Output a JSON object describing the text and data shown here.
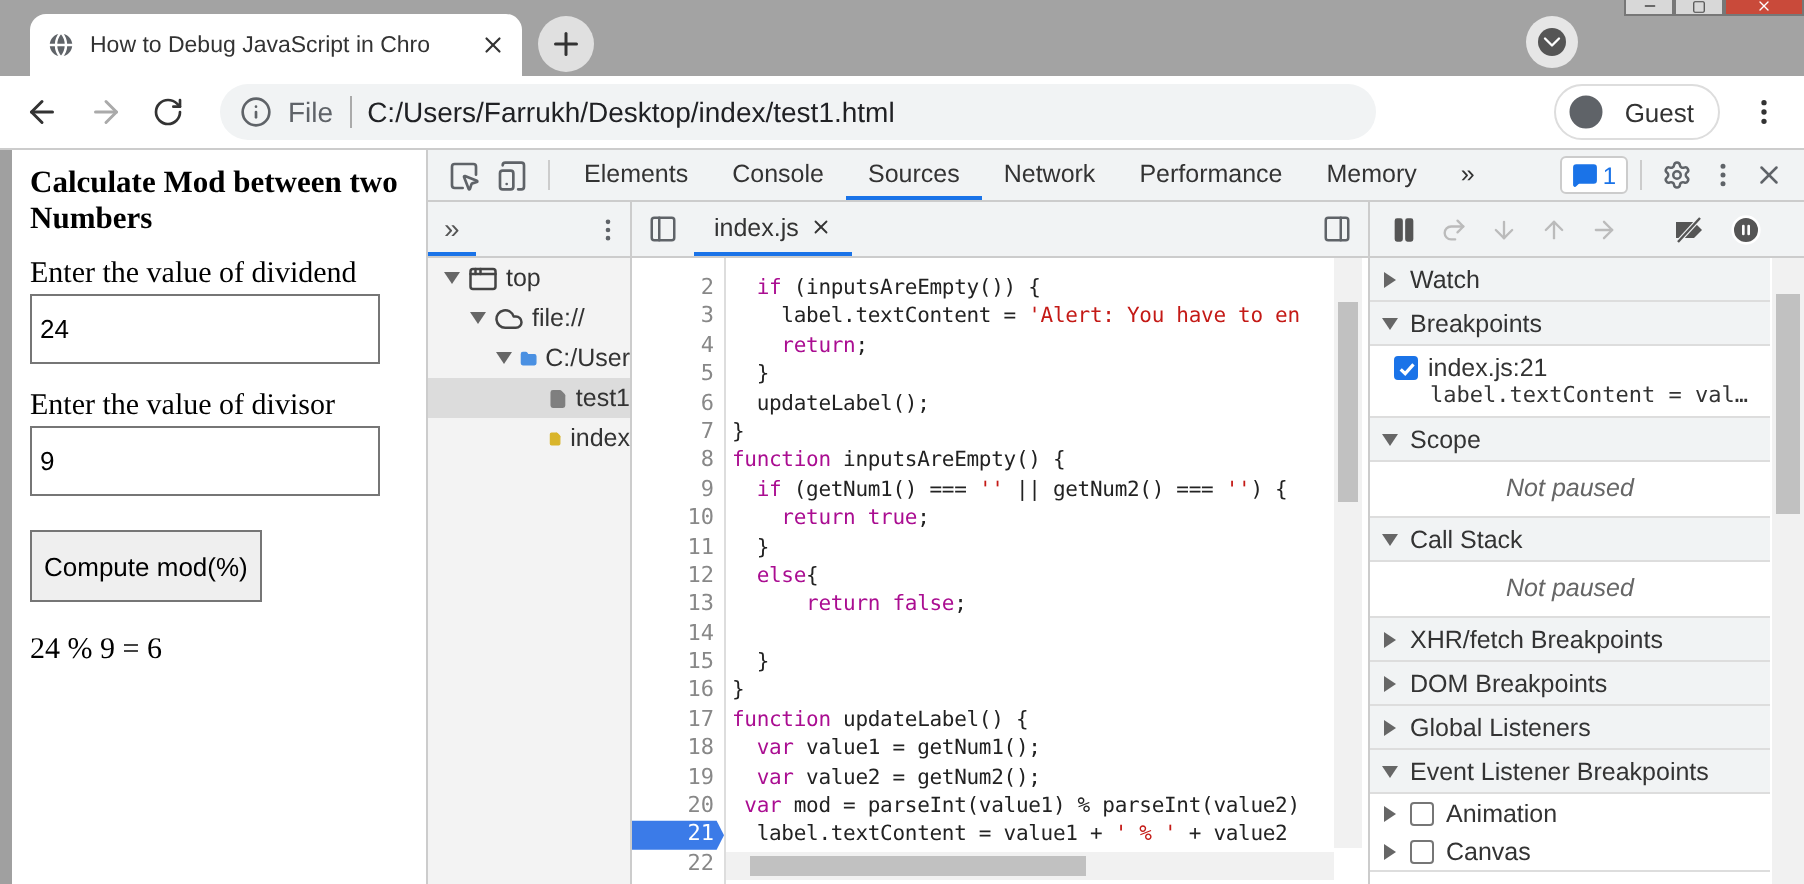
{
  "browser": {
    "tabs": [
      {
        "title": "How to Debug JavaScript in Chro",
        "selected": true
      }
    ],
    "address": {
      "scheme_label": "File",
      "url": "C:/Users/Farrukh/Desktop/index/test1.html"
    },
    "profile": {
      "label": "Guest"
    }
  },
  "page": {
    "heading": "Calculate Mod between two Numbers",
    "fields": [
      {
        "label": "Enter the value of dividend",
        "value": "24"
      },
      {
        "label": "Enter the value of divisor",
        "value": "9"
      }
    ],
    "button": "Compute mod(%)",
    "result": "24 % 9 = 6"
  },
  "devtools": {
    "tabs": [
      {
        "label": "Elements",
        "selected": false
      },
      {
        "label": "Console",
        "selected": false
      },
      {
        "label": "Sources",
        "selected": true
      },
      {
        "label": "Network",
        "selected": false
      },
      {
        "label": "Performance",
        "selected": false
      },
      {
        "label": "Memory",
        "selected": false
      }
    ],
    "more_tabs": "»",
    "issues_count": "1"
  },
  "sources": {
    "navigator": {
      "more": "»",
      "tree": [
        {
          "label": "top",
          "kind": "frame",
          "expanded": true,
          "selected": false,
          "children": [
            {
              "label": "file://",
              "kind": "origin",
              "expanded": true,
              "selected": false,
              "children": [
                {
                  "label": "C:/User",
                  "kind": "folder",
                  "expanded": true,
                  "selected": false,
                  "children": [
                    {
                      "label": "test1",
                      "kind": "file",
                      "color": "#7f7f7f",
                      "selected": true
                    },
                    {
                      "label": "index",
                      "kind": "file",
                      "color": "#d9b52b",
                      "selected": false
                    }
                  ]
                }
              ]
            }
          ]
        }
      ]
    },
    "editor": {
      "tab": "index.js",
      "lines": [
        {
          "number": "2",
          "tokens": [
            {
              "text": "  if",
              "kind": "kw"
            },
            {
              "text": " (inputsAreEmpty()) {",
              "kind": "plain"
            }
          ]
        },
        {
          "number": "3",
          "tokens": [
            {
              "text": "    label.textContent = ",
              "kind": "plain"
            },
            {
              "text": "'Alert: You have to en",
              "kind": "str"
            }
          ]
        },
        {
          "number": "4",
          "tokens": [
            {
              "text": "    return",
              "kind": "kw"
            },
            {
              "text": ";",
              "kind": "plain"
            }
          ]
        },
        {
          "number": "5",
          "tokens": [
            {
              "text": "  }",
              "kind": "plain"
            }
          ]
        },
        {
          "number": "6",
          "tokens": [
            {
              "text": "  updateLabel();",
              "kind": "plain"
            }
          ]
        },
        {
          "number": "7",
          "tokens": [
            {
              "text": "}",
              "kind": "plain"
            }
          ]
        },
        {
          "number": "8",
          "tokens": [
            {
              "text": "function",
              "kind": "kw"
            },
            {
              "text": " inputsAreEmpty() {",
              "kind": "plain"
            }
          ]
        },
        {
          "number": "9",
          "tokens": [
            {
              "text": "  if",
              "kind": "kw"
            },
            {
              "text": " (getNum1() === ",
              "kind": "plain"
            },
            {
              "text": "''",
              "kind": "str"
            },
            {
              "text": " || getNum2() === ",
              "kind": "plain"
            },
            {
              "text": "''",
              "kind": "str"
            },
            {
              "text": ") {",
              "kind": "plain"
            }
          ]
        },
        {
          "number": "10",
          "tokens": [
            {
              "text": "    return true",
              "kind": "kw"
            },
            {
              "text": ";",
              "kind": "plain"
            }
          ]
        },
        {
          "number": "11",
          "tokens": [
            {
              "text": "  }",
              "kind": "plain"
            }
          ]
        },
        {
          "number": "12",
          "tokens": [
            {
              "text": "  else",
              "kind": "kw"
            },
            {
              "text": "{",
              "kind": "plain"
            }
          ]
        },
        {
          "number": "13",
          "tokens": [
            {
              "text": "      return false",
              "kind": "kw"
            },
            {
              "text": ";",
              "kind": "plain"
            }
          ]
        },
        {
          "number": "14"
        },
        {
          "number": "15",
          "tokens": [
            {
              "text": "  }",
              "kind": "plain"
            }
          ]
        },
        {
          "number": "16",
          "tokens": [
            {
              "text": "}",
              "kind": "plain"
            }
          ]
        },
        {
          "number": "17",
          "tokens": [
            {
              "text": "function",
              "kind": "kw"
            },
            {
              "text": " updateLabel() {",
              "kind": "plain"
            }
          ]
        },
        {
          "number": "18",
          "tokens": [
            {
              "text": "  var",
              "kind": "kw"
            },
            {
              "text": " value1 = getNum1();",
              "kind": "plain"
            }
          ]
        },
        {
          "number": "19",
          "tokens": [
            {
              "text": "  var",
              "kind": "kw"
            },
            {
              "text": " value2 = getNum2();",
              "kind": "plain"
            }
          ]
        },
        {
          "number": "20",
          "tokens": [
            {
              "text": " var",
              "kind": "kw"
            },
            {
              "text": " mod = parseInt(value1) % parseInt(value2)",
              "kind": "plain"
            }
          ]
        },
        {
          "number": "21",
          "breakpoint": true,
          "tokens": [
            {
              "text": "  label.textContent = value1 + ",
              "kind": "plain"
            },
            {
              "text": "' % '",
              "kind": "str"
            },
            {
              "text": " + value2",
              "kind": "plain"
            }
          ]
        },
        {
          "number": "22"
        }
      ]
    },
    "debugger": {
      "sections": [
        {
          "title": "Watch",
          "expanded": false
        },
        {
          "title": "Breakpoints",
          "expanded": true,
          "kind": "breakpoints",
          "items": [
            {
              "location": "index.js:21",
              "code": "label.textContent = val…",
              "checked": true
            }
          ]
        },
        {
          "title": "Scope",
          "expanded": true,
          "kind": "message",
          "message": "Not paused"
        },
        {
          "title": "Call Stack",
          "expanded": true,
          "kind": "message",
          "message": "Not paused"
        },
        {
          "title": "XHR/fetch Breakpoints",
          "expanded": false
        },
        {
          "title": "DOM Breakpoints",
          "expanded": false
        },
        {
          "title": "Global Listeners",
          "expanded": false
        },
        {
          "title": "Event Listener Breakpoints",
          "expanded": true,
          "kind": "checklist",
          "items": [
            {
              "label": "Animation",
              "checked": false,
              "expanded": false
            },
            {
              "label": "Canvas",
              "checked": false,
              "expanded": false
            }
          ]
        }
      ]
    }
  }
}
